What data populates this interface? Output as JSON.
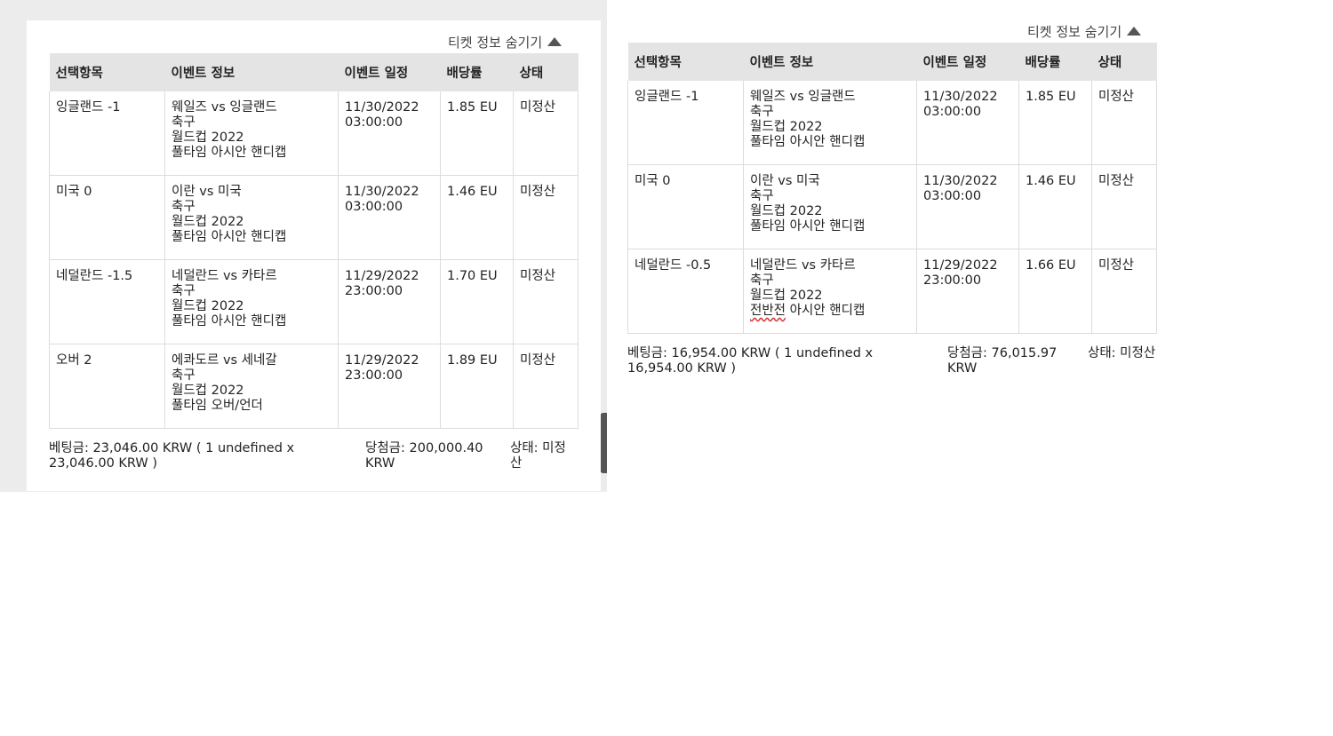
{
  "left_ticket": {
    "toggle_label": "티켓 정보 숨기기",
    "headers": [
      "선택항목",
      "이벤트 정보",
      "이벤트 일정",
      "배당률",
      "상태"
    ],
    "rows": [
      {
        "selection": "잉글랜드 -1",
        "match": "웨일즈 vs 잉글랜드",
        "sport": "축구",
        "league": "월드컵 2022",
        "market": "풀타임 아시안 핸디캡",
        "date": "11/30/2022",
        "time": "03:00:00",
        "odds": "1.85 EU",
        "status": "미정산"
      },
      {
        "selection": "미국 0",
        "match": "이란 vs 미국",
        "sport": "축구",
        "league": "월드컵 2022",
        "market": "풀타임 아시안 핸디캡",
        "date": "11/30/2022",
        "time": "03:00:00",
        "odds": "1.46 EU",
        "status": "미정산"
      },
      {
        "selection": "네덜란드 -1.5",
        "match": "네덜란드 vs 카타르",
        "sport": "축구",
        "league": "월드컵 2022",
        "market": "풀타임 아시안 핸디캡",
        "date": "11/29/2022",
        "time": "23:00:00",
        "odds": "1.70 EU",
        "status": "미정산"
      },
      {
        "selection": "오버 2",
        "match": "에콰도르 vs 세네갈",
        "sport": "축구",
        "league": "월드컵 2022",
        "market": "풀타임 오버/언더",
        "date": "11/29/2022",
        "time": "23:00:00",
        "odds": "1.89 EU",
        "status": "미정산"
      }
    ],
    "footer": {
      "bet_amount": "베팅금: 23,046.00 KRW ( 1 undefined x 23,046.00 KRW )",
      "payout": "당첨금: 200,000.40 KRW",
      "status": "상태: 미정산"
    }
  },
  "right_ticket": {
    "toggle_label": "티켓 정보 숨기기",
    "headers": [
      "선택항목",
      "이벤트 정보",
      "이벤트 일정",
      "배당률",
      "상태"
    ],
    "rows": [
      {
        "selection": "잉글랜드 -1",
        "match": "웨일즈 vs 잉글랜드",
        "sport": "축구",
        "league": "월드컵 2022",
        "market": "풀타임 아시안 핸디캡",
        "date": "11/30/2022",
        "time": "03:00:00",
        "odds": "1.85 EU",
        "status": "미정산"
      },
      {
        "selection": "미국 0",
        "match": "이란 vs 미국",
        "sport": "축구",
        "league": "월드컵 2022",
        "market": "풀타임 아시안 핸디캡",
        "date": "11/30/2022",
        "time": "03:00:00",
        "odds": "1.46 EU",
        "status": "미정산"
      },
      {
        "selection": "네덜란드 -0.5",
        "match": "네덜란드 vs 카타르",
        "sport": "축구",
        "league": "월드컵 2022",
        "market_prefix": "전반전",
        "market": " 아시안 핸디캡",
        "date": "11/29/2022",
        "time": "23:00:00",
        "odds": "1.66 EU",
        "status": "미정산"
      }
    ],
    "footer": {
      "bet_amount": "베팅금: 16,954.00 KRW ( 1 undefined x 16,954.00 KRW )",
      "payout": "당첨금: 76,015.97 KRW",
      "status": "상태: 미정산"
    }
  },
  "colors": {
    "accent_bar": "#ff7a00",
    "header_bg": "#e4e4e4",
    "pane_bg": "#ececec"
  },
  "icons": {
    "toggle": "triangle-up-icon"
  }
}
